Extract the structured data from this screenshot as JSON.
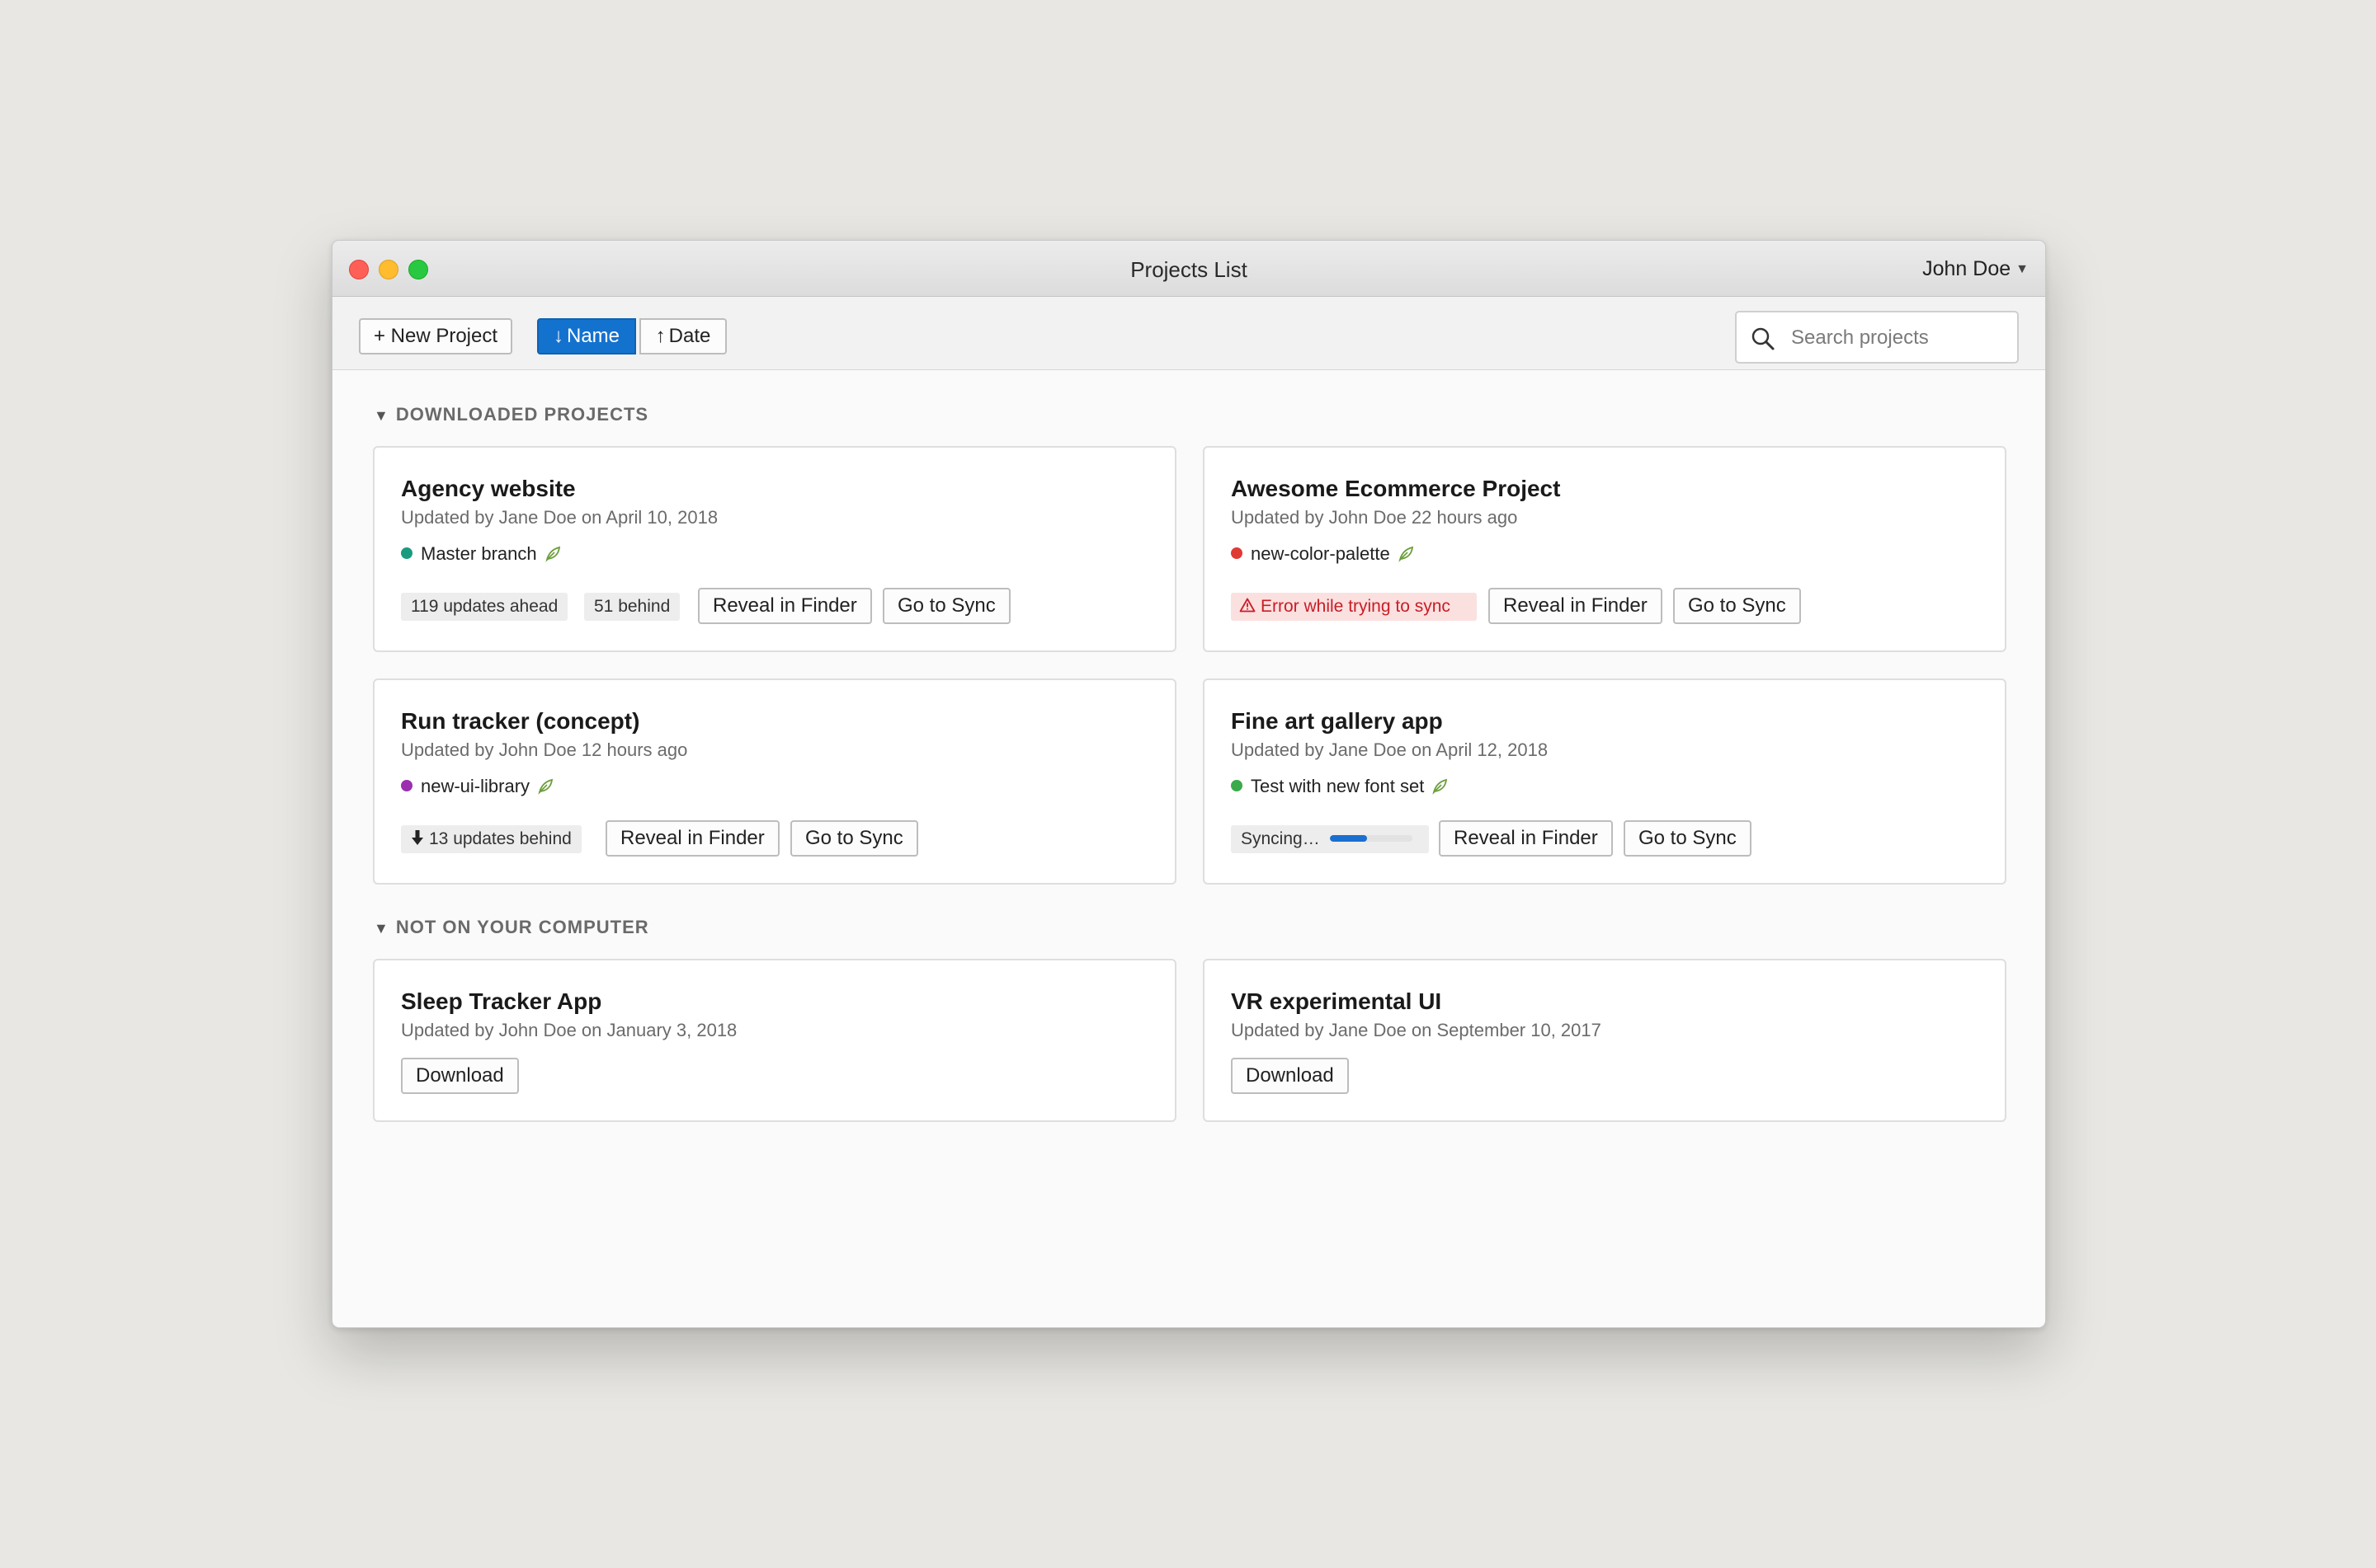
{
  "window": {
    "title": "Projects List",
    "user": "John Doe"
  },
  "toolbar": {
    "new_project": "+ New Project",
    "sort_name": "Name",
    "sort_date": "Date",
    "sort_active": "Name",
    "search_placeholder": "Search projects"
  },
  "sections": [
    {
      "title": "DOWNLOADED PROJECTS",
      "projects": [
        {
          "name": "Agency website",
          "updated": "Updated by Jane Doe on April 10, 2018",
          "branch": "Master branch",
          "branch_color": "#1a9b80",
          "ahead": "119 updates ahead",
          "behind": "51 behind",
          "reveal": "Reveal in Finder",
          "sync": "Go to Sync"
        },
        {
          "name": "Awesome Ecommerce Project",
          "updated": "Updated by John Doe 22 hours ago",
          "branch": "new-color-palette",
          "branch_color": "#e03a34",
          "error": "Error while trying to sync",
          "reveal": "Reveal in Finder",
          "sync": "Go to Sync"
        },
        {
          "name": "Run tracker (concept)",
          "updated": "Updated by John Doe 12 hours ago",
          "branch": "new-ui-library",
          "branch_color": "#9b2fb0",
          "behind": "13 updates behind",
          "reveal": "Reveal in Finder",
          "sync": "Go to Sync"
        },
        {
          "name": "Fine art gallery app",
          "updated": "Updated by Jane Doe on April 12, 2018",
          "branch": "Test with new font set",
          "branch_color": "#3aaa4a",
          "syncing": "Syncing…",
          "sync_progress": 0.45,
          "reveal": "Reveal in Finder",
          "sync": "Go to Sync"
        }
      ]
    },
    {
      "title": "NOT ON YOUR COMPUTER",
      "projects": [
        {
          "name": "Sleep Tracker App",
          "updated": "Updated by John Doe on January 3, 2018",
          "download": "Download"
        },
        {
          "name": "VR experimental UI",
          "updated": "Updated by Jane Doe on September 10, 2017",
          "download": "Download"
        }
      ]
    }
  ],
  "colors": {
    "accent": "#1472cf",
    "error_bg": "#fbe0e0",
    "error_text": "#c81d25"
  }
}
